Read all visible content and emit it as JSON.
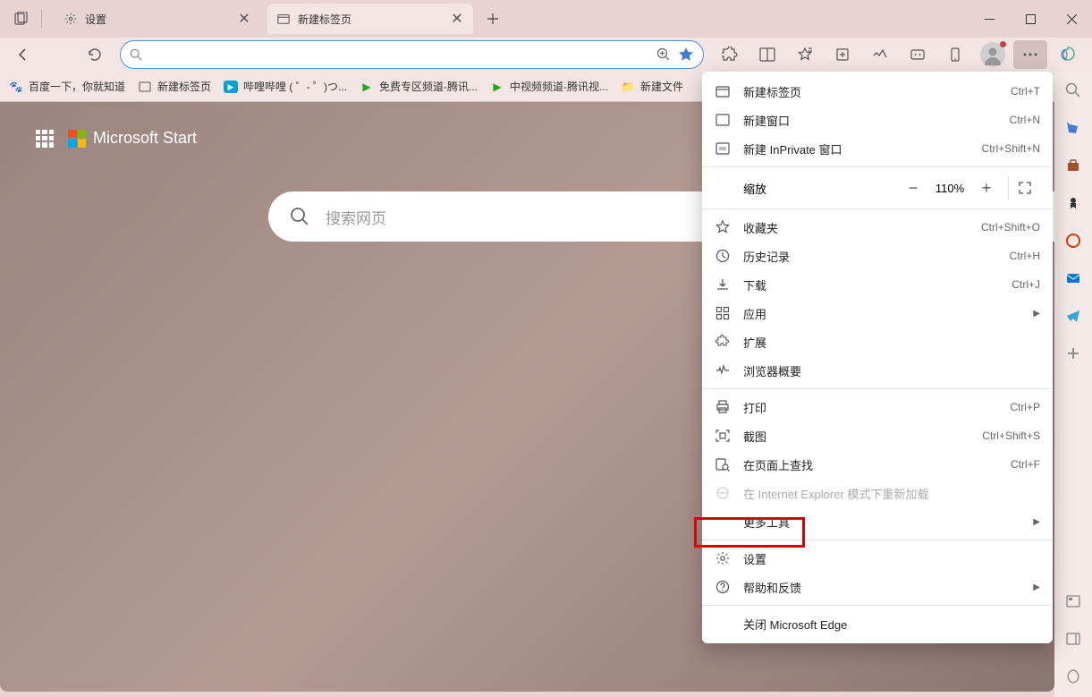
{
  "tabs": [
    {
      "title": "设置",
      "icon": "gear"
    },
    {
      "title": "新建标签页",
      "icon": "newtab"
    }
  ],
  "bookmarks": [
    {
      "label": "百度一下，你就知道",
      "color": "#3b7dd8"
    },
    {
      "label": "新建标签页",
      "color": "#555"
    },
    {
      "label": "哔哩哔哩 (  ゜- ゜)つ...",
      "color": "#00a1d6"
    },
    {
      "label": "免费专区频道-腾讯...",
      "color": "#1aad19"
    },
    {
      "label": "中视频频道-腾讯视...",
      "color": "#1aad19"
    },
    {
      "label": "新建文件",
      "color": "#f0a030"
    }
  ],
  "ms_start": "Microsoft Start",
  "search_placeholder": "搜索网页",
  "zoom": {
    "label": "缩放",
    "value": "110%"
  },
  "menu": {
    "new_tab": {
      "label": "新建标签页",
      "shortcut": "Ctrl+T"
    },
    "new_window": {
      "label": "新建窗口",
      "shortcut": "Ctrl+N"
    },
    "new_inprivate": {
      "label": "新建 InPrivate 窗口",
      "shortcut": "Ctrl+Shift+N"
    },
    "favorites": {
      "label": "收藏夹",
      "shortcut": "Ctrl+Shift+O"
    },
    "history": {
      "label": "历史记录",
      "shortcut": "Ctrl+H"
    },
    "downloads": {
      "label": "下载",
      "shortcut": "Ctrl+J"
    },
    "apps": {
      "label": "应用"
    },
    "extensions": {
      "label": "扩展"
    },
    "perf": {
      "label": "浏览器概要"
    },
    "print": {
      "label": "打印",
      "shortcut": "Ctrl+P"
    },
    "screenshot": {
      "label": "截图",
      "shortcut": "Ctrl+Shift+S"
    },
    "find": {
      "label": "在页面上查找",
      "shortcut": "Ctrl+F"
    },
    "ie_reload": {
      "label": "在 Internet Explorer 模式下重新加载"
    },
    "more_tools": {
      "label": "更多工具"
    },
    "settings": {
      "label": "设置"
    },
    "help": {
      "label": "帮助和反馈"
    },
    "close": {
      "label": "关闭 Microsoft Edge"
    }
  }
}
